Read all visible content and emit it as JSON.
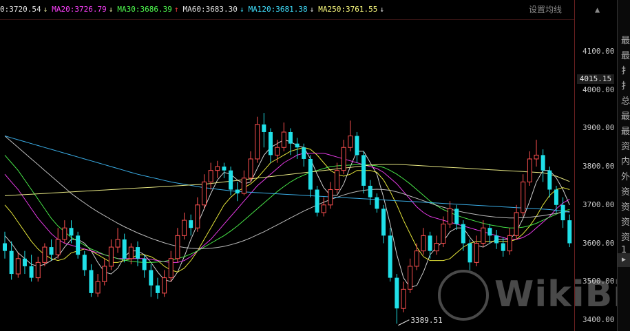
{
  "header": {
    "ma_items": [
      {
        "text": "0:3720.54",
        "arrow": "↓",
        "color": "#e6e6e6",
        "arrow_color": "#e6e6a0"
      },
      {
        "text": "MA20:3726.79",
        "arrow": "↓",
        "color": "#ff40ff",
        "arrow_color": "#e6e6a0"
      },
      {
        "text": "MA30:3686.39",
        "arrow": "↑",
        "color": "#50ff50",
        "arrow_color": "#ff4040"
      },
      {
        "text": "MA60:3683.30",
        "arrow": "↓",
        "color": "#e0e0e0",
        "arrow_color": "#40e0ff"
      },
      {
        "text": "MA120:3681.38",
        "arrow": "↓",
        "color": "#40e0ff",
        "arrow_color": "#e0e0e0"
      },
      {
        "text": "MA250:3761.55",
        "arrow": "↓",
        "color": "#ffff80",
        "arrow_color": "#e0e0e0"
      }
    ],
    "settings_label": "设置均线",
    "settings_arrow": "▲"
  },
  "right_panel": {
    "chars": [
      "最",
      "最",
      "扌",
      "扌",
      "总",
      "最",
      "最",
      "资",
      "内",
      "外",
      "资",
      "资",
      "资",
      "资",
      "1"
    ],
    "handle": "▶"
  },
  "price_axis": {
    "current_price": "4015.15"
  },
  "low_annotation": "3389.51",
  "watermark": "WikiBit",
  "colors": {
    "up": "#ff5050",
    "down": "#20e0e8",
    "ma5": "#e6e6e6",
    "ma10": "#ffff40",
    "ma20": "#ff40ff",
    "ma30": "#50ff50",
    "ma60": "#d0d0d0",
    "ma120": "#40c0ff",
    "ma250": "#ffff90"
  },
  "chart_data": {
    "type": "candlestick",
    "y_ticks": [
      3400,
      3500,
      3600,
      3700,
      3800,
      3900,
      4000,
      4100
    ],
    "y_tick_labels": [
      "3400.00",
      "3500.00",
      "3600.00",
      "3700.00",
      "3800.00",
      "3900.00",
      "4000.00",
      "4100.00"
    ],
    "ylim": [
      3380,
      4180
    ],
    "current_price": 4015.15,
    "low_marker": {
      "value": 3389.51,
      "label": "3389.51"
    },
    "candles": [
      [
        3600,
        3580,
        3560,
        3630
      ],
      [
        3580,
        3520,
        3505,
        3605
      ],
      [
        3520,
        3560,
        3510,
        3575
      ],
      [
        3560,
        3540,
        3520,
        3580
      ],
      [
        3540,
        3510,
        3500,
        3570
      ],
      [
        3510,
        3550,
        3500,
        3565
      ],
      [
        3550,
        3590,
        3540,
        3600
      ],
      [
        3590,
        3570,
        3555,
        3610
      ],
      [
        3570,
        3610,
        3560,
        3640
      ],
      [
        3610,
        3640,
        3600,
        3660
      ],
      [
        3640,
        3620,
        3600,
        3660
      ],
      [
        3620,
        3570,
        3560,
        3630
      ],
      [
        3570,
        3530,
        3515,
        3580
      ],
      [
        3530,
        3470,
        3460,
        3545
      ],
      [
        3470,
        3500,
        3460,
        3520
      ],
      [
        3500,
        3540,
        3490,
        3560
      ],
      [
        3540,
        3590,
        3530,
        3610
      ],
      [
        3590,
        3610,
        3575,
        3640
      ],
      [
        3610,
        3560,
        3550,
        3625
      ],
      [
        3560,
        3590,
        3545,
        3600
      ],
      [
        3590,
        3560,
        3540,
        3605
      ],
      [
        3560,
        3530,
        3510,
        3570
      ],
      [
        3530,
        3490,
        3460,
        3545
      ],
      [
        3490,
        3470,
        3455,
        3510
      ],
      [
        3470,
        3510,
        3460,
        3530
      ],
      [
        3510,
        3560,
        3500,
        3580
      ],
      [
        3560,
        3620,
        3550,
        3640
      ],
      [
        3620,
        3660,
        3610,
        3680
      ],
      [
        3660,
        3640,
        3620,
        3675
      ],
      [
        3640,
        3700,
        3630,
        3720
      ],
      [
        3700,
        3760,
        3690,
        3780
      ],
      [
        3760,
        3790,
        3740,
        3810
      ],
      [
        3790,
        3800,
        3770,
        3815
      ],
      [
        3800,
        3790,
        3770,
        3810
      ],
      [
        3790,
        3740,
        3725,
        3800
      ],
      [
        3740,
        3730,
        3710,
        3760
      ],
      [
        3730,
        3770,
        3725,
        3790
      ],
      [
        3770,
        3820,
        3760,
        3840
      ],
      [
        3820,
        3910,
        3810,
        3930
      ],
      [
        3910,
        3890,
        3850,
        3940
      ],
      [
        3890,
        3830,
        3810,
        3900
      ],
      [
        3830,
        3850,
        3810,
        3870
      ],
      [
        3850,
        3890,
        3840,
        3915
      ],
      [
        3890,
        3860,
        3830,
        3900
      ],
      [
        3860,
        3850,
        3820,
        3875
      ],
      [
        3850,
        3820,
        3800,
        3860
      ],
      [
        3820,
        3740,
        3720,
        3830
      ],
      [
        3740,
        3680,
        3670,
        3750
      ],
      [
        3680,
        3700,
        3670,
        3720
      ],
      [
        3700,
        3740,
        3690,
        3760
      ],
      [
        3740,
        3790,
        3730,
        3810
      ],
      [
        3790,
        3850,
        3780,
        3870
      ],
      [
        3850,
        3880,
        3840,
        3920
      ],
      [
        3880,
        3830,
        3810,
        3890
      ],
      [
        3830,
        3750,
        3730,
        3840
      ],
      [
        3750,
        3720,
        3700,
        3765
      ],
      [
        3720,
        3690,
        3680,
        3730
      ],
      [
        3690,
        3620,
        3600,
        3700
      ],
      [
        3620,
        3510,
        3500,
        3640
      ],
      [
        3510,
        3430,
        3390,
        3520
      ],
      [
        3430,
        3480,
        3420,
        3500
      ],
      [
        3480,
        3540,
        3470,
        3560
      ],
      [
        3540,
        3580,
        3530,
        3600
      ],
      [
        3580,
        3620,
        3570,
        3640
      ],
      [
        3620,
        3580,
        3560,
        3630
      ],
      [
        3580,
        3600,
        3570,
        3620
      ],
      [
        3600,
        3650,
        3590,
        3670
      ],
      [
        3650,
        3690,
        3640,
        3710
      ],
      [
        3690,
        3650,
        3635,
        3700
      ],
      [
        3650,
        3600,
        3580,
        3660
      ],
      [
        3600,
        3550,
        3530,
        3610
      ],
      [
        3550,
        3600,
        3540,
        3620
      ],
      [
        3600,
        3640,
        3590,
        3660
      ],
      [
        3640,
        3620,
        3600,
        3650
      ],
      [
        3620,
        3600,
        3585,
        3635
      ],
      [
        3600,
        3580,
        3565,
        3615
      ],
      [
        3580,
        3620,
        3570,
        3640
      ],
      [
        3620,
        3680,
        3610,
        3700
      ],
      [
        3680,
        3760,
        3670,
        3780
      ],
      [
        3760,
        3820,
        3750,
        3840
      ],
      [
        3820,
        3830,
        3800,
        3870
      ],
      [
        3830,
        3790,
        3760,
        3845
      ],
      [
        3790,
        3740,
        3720,
        3800
      ],
      [
        3740,
        3700,
        3680,
        3750
      ],
      [
        3700,
        3660,
        3640,
        3720
      ],
      [
        3660,
        3600,
        3590,
        3675
      ]
    ],
    "ma_series": [
      {
        "name": "MA5",
        "values": [
          3620,
          3600,
          3575,
          3560,
          3545,
          3540,
          3545,
          3555,
          3565,
          3590,
          3610,
          3610,
          3600,
          3580,
          3550,
          3525,
          3520,
          3535,
          3565,
          3580,
          3580,
          3570,
          3550,
          3525,
          3505,
          3500,
          3525,
          3565,
          3610,
          3650,
          3690,
          3730,
          3765,
          3785,
          3780,
          3765,
          3755,
          3760,
          3795,
          3830,
          3850,
          3860,
          3870,
          3865,
          3855,
          3850,
          3820,
          3780,
          3745,
          3725,
          3725,
          3755,
          3800,
          3840,
          3840,
          3810,
          3780,
          3720,
          3650,
          3570,
          3510,
          3485,
          3490,
          3525,
          3570,
          3590,
          3605,
          3630,
          3640,
          3640,
          3615,
          3595,
          3590,
          3600,
          3610,
          3610,
          3610,
          3630,
          3665,
          3710,
          3760,
          3790,
          3790,
          3770,
          3740,
          3700
        ]
      },
      {
        "name": "MA10",
        "values": [
          3700,
          3680,
          3655,
          3630,
          3605,
          3585,
          3570,
          3560,
          3555,
          3560,
          3575,
          3580,
          3585,
          3580,
          3570,
          3560,
          3550,
          3550,
          3555,
          3560,
          3570,
          3570,
          3565,
          3555,
          3540,
          3530,
          3525,
          3535,
          3555,
          3580,
          3610,
          3640,
          3670,
          3700,
          3720,
          3735,
          3745,
          3755,
          3770,
          3790,
          3810,
          3820,
          3830,
          3840,
          3845,
          3850,
          3845,
          3830,
          3810,
          3790,
          3780,
          3775,
          3780,
          3790,
          3790,
          3790,
          3785,
          3765,
          3735,
          3700,
          3660,
          3625,
          3590,
          3565,
          3555,
          3555,
          3555,
          3560,
          3575,
          3590,
          3600,
          3605,
          3605,
          3605,
          3605,
          3605,
          3605,
          3610,
          3625,
          3645,
          3670,
          3700,
          3725,
          3740,
          3745,
          3740
        ]
      },
      {
        "name": "MA20",
        "values": [
          3780,
          3760,
          3740,
          3715,
          3690,
          3665,
          3645,
          3625,
          3610,
          3600,
          3595,
          3590,
          3585,
          3580,
          3575,
          3570,
          3565,
          3560,
          3560,
          3560,
          3560,
          3560,
          3558,
          3555,
          3552,
          3550,
          3550,
          3555,
          3565,
          3580,
          3595,
          3610,
          3630,
          3650,
          3670,
          3690,
          3710,
          3730,
          3750,
          3765,
          3780,
          3795,
          3810,
          3820,
          3830,
          3835,
          3835,
          3835,
          3835,
          3830,
          3825,
          3820,
          3815,
          3810,
          3805,
          3800,
          3795,
          3785,
          3770,
          3755,
          3735,
          3715,
          3695,
          3680,
          3670,
          3665,
          3660,
          3655,
          3650,
          3645,
          3640,
          3635,
          3630,
          3625,
          3620,
          3615,
          3610,
          3610,
          3615,
          3625,
          3640,
          3655,
          3670,
          3690,
          3705,
          3715
        ]
      },
      {
        "name": "MA30",
        "values": [
          3830,
          3810,
          3790,
          3765,
          3740,
          3715,
          3690,
          3665,
          3645,
          3630,
          3615,
          3605,
          3595,
          3585,
          3578,
          3570,
          3565,
          3560,
          3556,
          3553,
          3551,
          3550,
          3550,
          3551,
          3553,
          3556,
          3560,
          3565,
          3572,
          3580,
          3590,
          3600,
          3610,
          3620,
          3632,
          3645,
          3660,
          3675,
          3690,
          3705,
          3720,
          3735,
          3748,
          3760,
          3770,
          3778,
          3785,
          3790,
          3795,
          3800,
          3802,
          3803,
          3804,
          3805,
          3805,
          3804,
          3802,
          3798,
          3790,
          3780,
          3768,
          3755,
          3740,
          3725,
          3710,
          3698,
          3688,
          3680,
          3673,
          3667,
          3662,
          3657,
          3652,
          3648,
          3645,
          3642,
          3640,
          3640,
          3642,
          3646,
          3652,
          3660,
          3668,
          3676,
          3684,
          3688
        ]
      },
      {
        "name": "MA60",
        "values": [
          3880,
          3865,
          3850,
          3835,
          3820,
          3805,
          3790,
          3775,
          3760,
          3745,
          3730,
          3717,
          3705,
          3693,
          3682,
          3672,
          3662,
          3652,
          3643,
          3635,
          3627,
          3620,
          3613,
          3607,
          3601,
          3596,
          3592,
          3589,
          3587,
          3586,
          3586,
          3587,
          3589,
          3592,
          3596,
          3601,
          3607,
          3614,
          3622,
          3630,
          3639,
          3648,
          3657,
          3666,
          3675,
          3684,
          3692,
          3700,
          3707,
          3714,
          3720,
          3726,
          3731,
          3735,
          3738,
          3740,
          3741,
          3740,
          3738,
          3734,
          3729,
          3723,
          3717,
          3711,
          3705,
          3699,
          3694,
          3689,
          3685,
          3681,
          3678,
          3675,
          3672,
          3670,
          3668,
          3667,
          3666,
          3666,
          3667,
          3668,
          3670,
          3672,
          3675,
          3678,
          3681,
          3683
        ]
      },
      {
        "name": "MA120",
        "values": [
          3880,
          3875,
          3870,
          3865,
          3860,
          3855,
          3850,
          3845,
          3840,
          3835,
          3830,
          3825,
          3820,
          3815,
          3810,
          3805,
          3800,
          3795,
          3790,
          3785,
          3780,
          3776,
          3772,
          3768,
          3764,
          3760,
          3757,
          3754,
          3751,
          3748,
          3745,
          3743,
          3741,
          3739,
          3737,
          3735,
          3734,
          3733,
          3732,
          3731,
          3730,
          3729,
          3728,
          3727,
          3726,
          3725,
          3724,
          3723,
          3722,
          3721,
          3720,
          3719,
          3718,
          3717,
          3716,
          3715,
          3714,
          3713,
          3712,
          3711,
          3710,
          3709,
          3708,
          3707,
          3706,
          3705,
          3704,
          3703,
          3702,
          3701,
          3700,
          3699,
          3698,
          3697,
          3696,
          3695,
          3694,
          3693,
          3692,
          3691,
          3690,
          3689,
          3688,
          3686,
          3684,
          3681
        ]
      },
      {
        "name": "MA250",
        "values": [
          3724,
          3725,
          3726,
          3727,
          3728,
          3729,
          3730,
          3731,
          3732,
          3733,
          3734,
          3735,
          3736,
          3737,
          3738,
          3739,
          3740,
          3741,
          3742,
          3743,
          3744,
          3745,
          3746,
          3747,
          3748,
          3749,
          3750,
          3751,
          3752,
          3753,
          3754,
          3756,
          3758,
          3760,
          3762,
          3764,
          3766,
          3768,
          3770,
          3772,
          3774,
          3776,
          3778,
          3780,
          3782,
          3784,
          3786,
          3788,
          3790,
          3792,
          3794,
          3796,
          3798,
          3800,
          3802,
          3804,
          3805,
          3806,
          3806,
          3806,
          3805,
          3804,
          3803,
          3802,
          3801,
          3800,
          3799,
          3798,
          3797,
          3796,
          3795,
          3794,
          3793,
          3792,
          3791,
          3790,
          3789,
          3788,
          3787,
          3786,
          3785,
          3784,
          3780,
          3775,
          3768,
          3761
        ]
      }
    ]
  }
}
